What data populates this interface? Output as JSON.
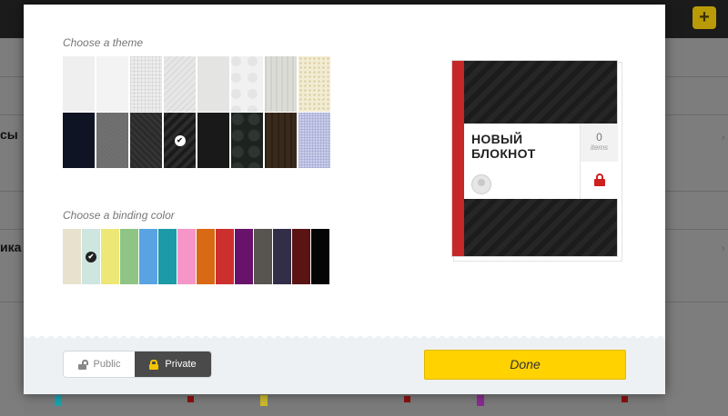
{
  "background": {
    "row_labels": [
      "сы",
      "ика"
    ]
  },
  "theme_picker": {
    "label": "Choose a theme",
    "selected_index": 11,
    "themes": [
      {
        "name": "white-plain",
        "color": "#efefef"
      },
      {
        "name": "white-texture",
        "color": "#f3f3f3"
      },
      {
        "name": "light-grid",
        "color": "#ececec"
      },
      {
        "name": "light-diagonal",
        "color": "#e6e6e6"
      },
      {
        "name": "light-linen",
        "color": "#e4e4e2"
      },
      {
        "name": "white-floral",
        "color": "#f1f1f1"
      },
      {
        "name": "wood-grain-light",
        "color": "#dcdcd6"
      },
      {
        "name": "cream-dots",
        "color": "#f2ecd4"
      },
      {
        "name": "navy-leather",
        "color": "#0e1424"
      },
      {
        "name": "gray-felt",
        "color": "#6c6c6c"
      },
      {
        "name": "dark-pattern",
        "color": "#2b2b2b"
      },
      {
        "name": "dark-diagonal",
        "color": "#1f1f1f"
      },
      {
        "name": "black-solid",
        "color": "#191919"
      },
      {
        "name": "dark-floral",
        "color": "#1d2420"
      },
      {
        "name": "dark-wood",
        "color": "#3a2a1c"
      },
      {
        "name": "blue-grid",
        "color": "#c9cde8"
      }
    ]
  },
  "binding_picker": {
    "label": "Choose a binding color",
    "selected_index": 1,
    "colors": [
      "#e7e1ce",
      "#cde6df",
      "#ece777",
      "#8ec585",
      "#5aa3e2",
      "#1c9aa8",
      "#f695c8",
      "#d86a15",
      "#cd2f2f",
      "#68126b",
      "#585550",
      "#322e48",
      "#5a1414",
      "#050505"
    ]
  },
  "preview": {
    "title": "НОВЫЙ БЛОКНОТ",
    "item_count": "0",
    "item_label": "items",
    "binding_color": "#c62828"
  },
  "privacy": {
    "public_label": "Public",
    "private_label": "Private",
    "selected": "private"
  },
  "done_label": "Done",
  "colors": {
    "accent": "#ffd200",
    "lock_red": "#d01f1f"
  }
}
